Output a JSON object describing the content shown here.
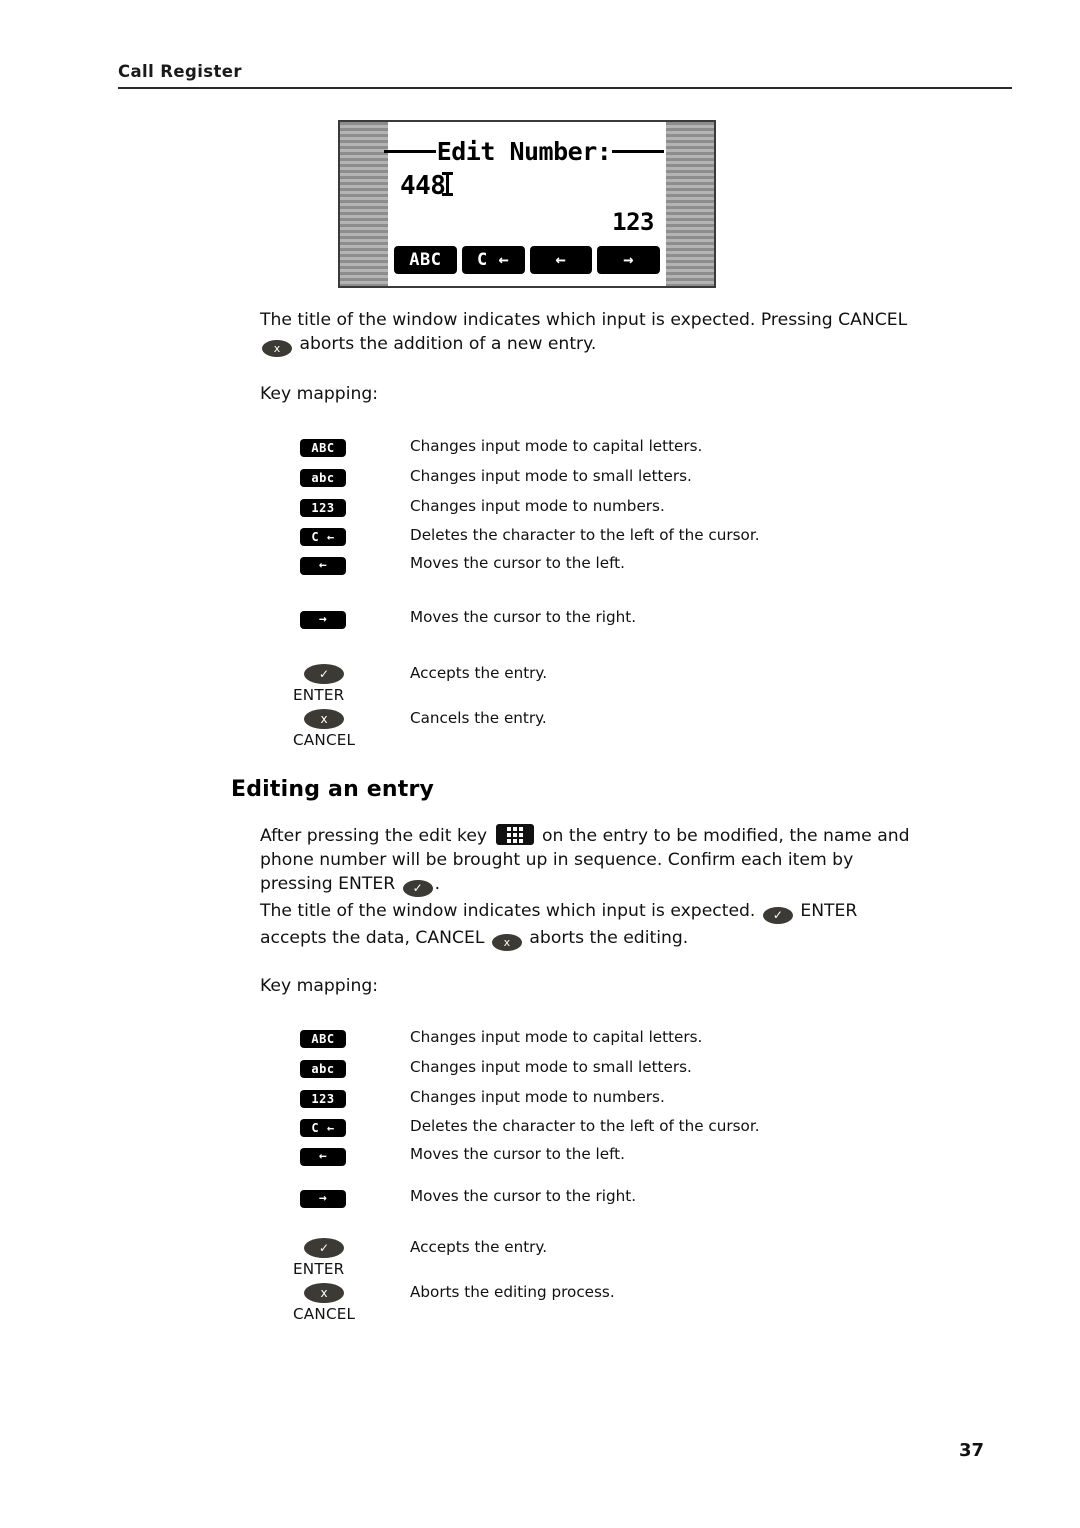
{
  "header": {
    "title": "Call Register",
    "page_number": "37"
  },
  "lcd": {
    "title": "Edit Number:",
    "value": "448",
    "mode_indicator": "123",
    "softkeys": [
      {
        "label": "ABC",
        "name": "softkey-abc"
      },
      {
        "label": "C ←",
        "name": "softkey-backspace"
      },
      {
        "label": "←",
        "name": "softkey-left"
      },
      {
        "label": "→",
        "name": "softkey-right"
      }
    ]
  },
  "section_add": {
    "paragraph_part1": "The title of the window indicates which input is expected.  Pressing CANCEL",
    "paragraph_part2": "aborts the addition of a new entry.",
    "key_mapping_label": "Key mapping:",
    "rows": [
      {
        "key": "ABC",
        "key_type": "chip",
        "desc": "Changes input mode to capital letters."
      },
      {
        "key": "abc",
        "key_type": "chip",
        "desc": "Changes input mode to small letters."
      },
      {
        "key": "123",
        "key_type": "chip",
        "desc": "Changes input mode to numbers."
      },
      {
        "key": "C ←",
        "key_type": "chip",
        "desc": "Deletes the character to the left of the cursor."
      },
      {
        "key": "←",
        "key_type": "chip",
        "desc": "Moves the cursor to the left."
      },
      {
        "key": "→",
        "key_type": "chip",
        "desc": "Moves the cursor to the right."
      },
      {
        "key": "✓",
        "key_type": "oval",
        "hw_label": "ENTER",
        "desc": "Accepts the entry."
      },
      {
        "key": "x",
        "key_type": "oval",
        "hw_label": "CANCEL",
        "desc": "Cancels the entry."
      }
    ]
  },
  "section_edit": {
    "heading": "Editing an entry",
    "paragraph1_part1": "After pressing the edit key",
    "paragraph1_part2": "on the entry to be modified, the name and phone number will be brought up in sequence. Confirm each item by pressing ENTER",
    "paragraph1_part3": ".",
    "paragraph2_part1": "The title of the window indicates which input is expected.",
    "paragraph2_part2": "ENTER accepts the data, CANCEL",
    "paragraph2_part3": "aborts the editing.",
    "key_mapping_label": "Key mapping:",
    "rows": [
      {
        "key": "ABC",
        "key_type": "chip",
        "desc": "Changes input mode to capital letters."
      },
      {
        "key": "abc",
        "key_type": "chip",
        "desc": "Changes input mode to small letters."
      },
      {
        "key": "123",
        "key_type": "chip",
        "desc": "Changes input mode to numbers."
      },
      {
        "key": "C ←",
        "key_type": "chip",
        "desc": "Deletes the character to the left of the cursor."
      },
      {
        "key": "←",
        "key_type": "chip",
        "desc": "Moves the cursor to the left."
      },
      {
        "key": "→",
        "key_type": "chip",
        "desc": "Moves the cursor to the right."
      },
      {
        "key": "✓",
        "key_type": "oval",
        "hw_label": "ENTER",
        "desc": "Accepts the entry."
      },
      {
        "key": "x",
        "key_type": "oval",
        "hw_label": "CANCEL",
        "desc": "Aborts the editing process."
      }
    ]
  },
  "colors": {
    "key_black": "#000000",
    "hw_key_dark": "#3b3a35",
    "bezel_gray": "#9a9a9a",
    "rule": "#2a2a2a"
  }
}
